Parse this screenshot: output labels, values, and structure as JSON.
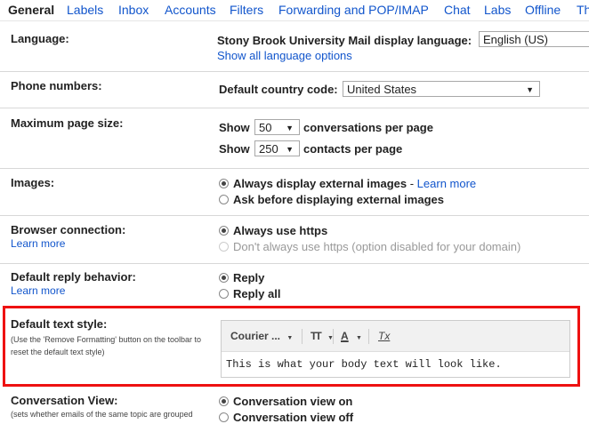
{
  "tabs": [
    "General",
    "Labels",
    "Inbox",
    "Accounts",
    "Filters",
    "Forwarding and POP/IMAP",
    "Chat",
    "Labs",
    "Offline",
    "Th"
  ],
  "language": {
    "label": "Language:",
    "display_text": "Stony Brook University Mail display language:",
    "selected": "English (US)",
    "show_all": "Show all language options"
  },
  "phone": {
    "label": "Phone numbers:",
    "country_label": "Default country code:",
    "country": "United States"
  },
  "page_size": {
    "label": "Maximum page size:",
    "show1": "Show",
    "conv_value": "50",
    "conv_suffix": "conversations per page",
    "show2": "Show",
    "contacts_value": "250",
    "contacts_suffix": "contacts per page"
  },
  "images": {
    "label": "Images:",
    "opt1": "Always display external images",
    "sep": " - ",
    "learn": "Learn more",
    "opt2": "Ask before displaying external images"
  },
  "browser": {
    "label": "Browser connection:",
    "learn": "Learn more",
    "opt1": "Always use https",
    "opt2": "Don't always use https (option disabled for your domain)"
  },
  "reply": {
    "label": "Default reply behavior:",
    "learn": "Learn more",
    "opt1": "Reply",
    "opt2": "Reply all"
  },
  "text_style": {
    "label": "Default text style:",
    "note": "(Use the 'Remove Formatting' button on the toolbar to reset the default text style)",
    "font": "Courier ...",
    "size_icon": "TT",
    "color_icon": "A",
    "remove_icon": "Tx",
    "preview": "This is what your body text will look like."
  },
  "conversation": {
    "label": "Conversation View:",
    "note": "(sets whether emails of the same topic are grouped",
    "opt1": "Conversation view on",
    "opt2": "Conversation view off"
  },
  "colors": {
    "link": "#1155cc",
    "highlight": "#ee1111"
  }
}
